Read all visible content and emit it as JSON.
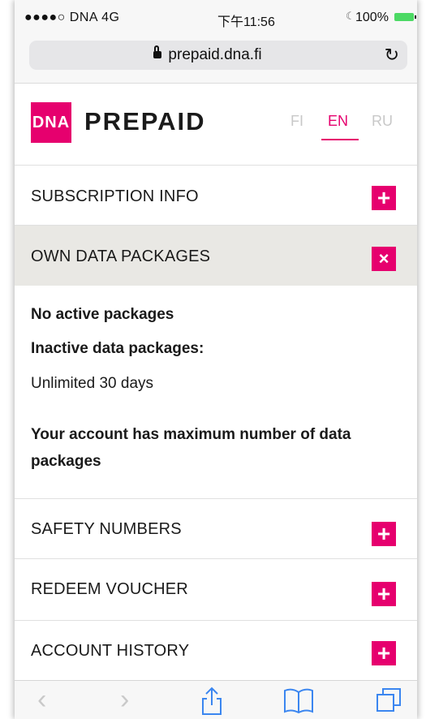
{
  "status_bar": {
    "carrier": "●●●●○ DNA  4G",
    "time": "下午11:56",
    "battery": "100%"
  },
  "browser": {
    "url": "prepaid.dna.fi",
    "reload_icon": "reload-icon",
    "toolbar_icons": [
      "back-icon",
      "forward-icon",
      "share-icon",
      "bookmarks-icon",
      "tabs-icon"
    ]
  },
  "header": {
    "logo_text": "DNA",
    "brand": "PREPAID",
    "languages": [
      "FI",
      "EN",
      "RU"
    ],
    "active_language": "EN",
    "accent_color": "#e6006e"
  },
  "sections": {
    "subscription_info": {
      "label": "SUBSCRIPTION INFO",
      "button": "+"
    },
    "own_data_packages": {
      "label": "OWN DATA PACKAGES",
      "button": "×"
    },
    "safety_numbers": {
      "label": "SAFETY NUMBERS",
      "button": "+"
    },
    "redeem_voucher": {
      "label": "REDEEM VOUCHER",
      "button": "+"
    },
    "account_history": {
      "label": "ACCOUNT HISTORY",
      "button": "+"
    }
  },
  "data_packages": {
    "no_active": "No active packages",
    "inactive_heading": "Inactive data packages:",
    "inactive_item": "Unlimited 30 days",
    "max_notice_line1": "Your account has maximum number of data",
    "max_notice_line2": "packages"
  }
}
